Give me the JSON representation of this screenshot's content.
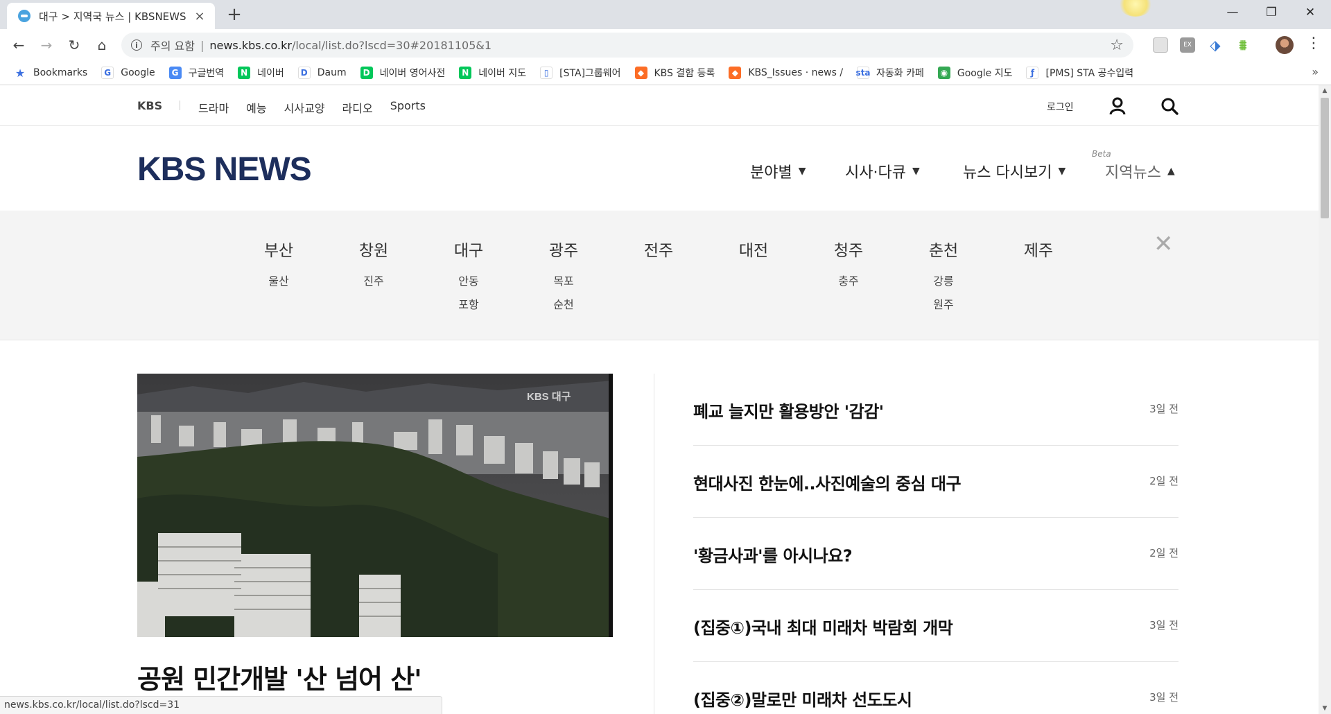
{
  "browser": {
    "tab_title": "대구 > 지역국 뉴스 | KBSNEWS",
    "tab_close": "×",
    "new_tab": "+",
    "security_label": "주의 요함",
    "url_host": "news.kbs.co.kr",
    "url_path": "/local/list.do?lscd=30#20181105&1",
    "window_controls": {
      "minimize": "—",
      "restore": "❐",
      "close": "✕"
    },
    "nav": {
      "back": "←",
      "forward": "→",
      "reload": "↻",
      "home": "⌂"
    },
    "bookmark_more": "»",
    "bookmarks": [
      {
        "label": "Bookmarks",
        "icon": "star-icon",
        "color": "#3b6fe0",
        "glyph": "★"
      },
      {
        "label": "Google",
        "icon": "google-icon",
        "color": "#ffffff",
        "glyph": "G"
      },
      {
        "label": "구글번역",
        "icon": "translate-icon",
        "color": "#4a8af4",
        "glyph": "G"
      },
      {
        "label": "네이버",
        "icon": "naver-icon",
        "color": "#03c75a",
        "glyph": "N"
      },
      {
        "label": "Daum",
        "icon": "daum-icon",
        "color": "#ffffff",
        "glyph": "D"
      },
      {
        "label": "네이버 영어사전",
        "icon": "dict-icon",
        "color": "#03c75a",
        "glyph": "D"
      },
      {
        "label": "네이버 지도",
        "icon": "naver-map-icon",
        "color": "#03c75a",
        "glyph": "N"
      },
      {
        "label": "[STA]그룹웨어",
        "icon": "document-icon",
        "color": "#ffffff",
        "glyph": "▯"
      },
      {
        "label": "KBS 결함 등록",
        "icon": "gitlab-icon",
        "color": "#fc6d26",
        "glyph": "◆"
      },
      {
        "label": "KBS_Issues · news / ",
        "icon": "gitlab-icon",
        "color": "#fc6d26",
        "glyph": "◆"
      },
      {
        "label": "자동화 카페",
        "icon": "sta-icon",
        "color": "#ffffff",
        "glyph": "sta"
      },
      {
        "label": "Google 지도",
        "icon": "maps-icon",
        "color": "#34a853",
        "glyph": "◉"
      },
      {
        "label": "[PMS] STA 공수입력",
        "icon": "pms-icon",
        "color": "#ffffff",
        "glyph": "ƒ"
      }
    ]
  },
  "site": {
    "gnb": {
      "brand": "KBS",
      "menu": [
        "드라마",
        "예능",
        "시사교양",
        "라디오",
        "Sports"
      ],
      "login": "로그인"
    },
    "logo": "KBS NEWS",
    "main_nav": [
      {
        "label": "분야별",
        "caret": "▼"
      },
      {
        "label": "시사·다큐",
        "caret": "▼"
      },
      {
        "label": "뉴스 다시보기",
        "caret": "▼"
      },
      {
        "label": "지역뉴스",
        "caret": "▲"
      }
    ],
    "beta": "Beta",
    "region_close": "✕",
    "regions": [
      {
        "main": "부산",
        "subs": [
          "울산"
        ]
      },
      {
        "main": "창원",
        "subs": [
          "진주"
        ]
      },
      {
        "main": "대구",
        "subs": [
          "안동",
          "포항"
        ]
      },
      {
        "main": "광주",
        "subs": [
          "목포",
          "순천"
        ]
      },
      {
        "main": "전주",
        "subs": []
      },
      {
        "main": "대전",
        "subs": []
      },
      {
        "main": "청주",
        "subs": [
          "충주"
        ]
      },
      {
        "main": "춘천",
        "subs": [
          "강릉",
          "원주"
        ]
      },
      {
        "main": "제주",
        "subs": []
      }
    ],
    "feature": {
      "watermark": "KBS 대구",
      "title": "공원 민간개발 '산 넘어 산'"
    },
    "news": [
      {
        "title": "폐교 늘지만 활용방안 '감감'",
        "time": "3일 전"
      },
      {
        "title": "현대사진 한눈에..사진예술의 중심 대구",
        "time": "2일 전"
      },
      {
        "title": "'황금사과'를 아시나요?",
        "time": "2일 전"
      },
      {
        "title": "(집중①)국내 최대 미래차 박람회 개막",
        "time": "3일 전"
      },
      {
        "title": "(집중②)말로만 미래차 선도도시",
        "time": "3일 전"
      }
    ]
  },
  "statusbar": {
    "url": "news.kbs.co.kr/local/list.do?lscd=31"
  },
  "colors": {
    "logo": "#1d2e5c",
    "region_bg": "#f4f4f4",
    "tabbar": "#dee1e6"
  }
}
